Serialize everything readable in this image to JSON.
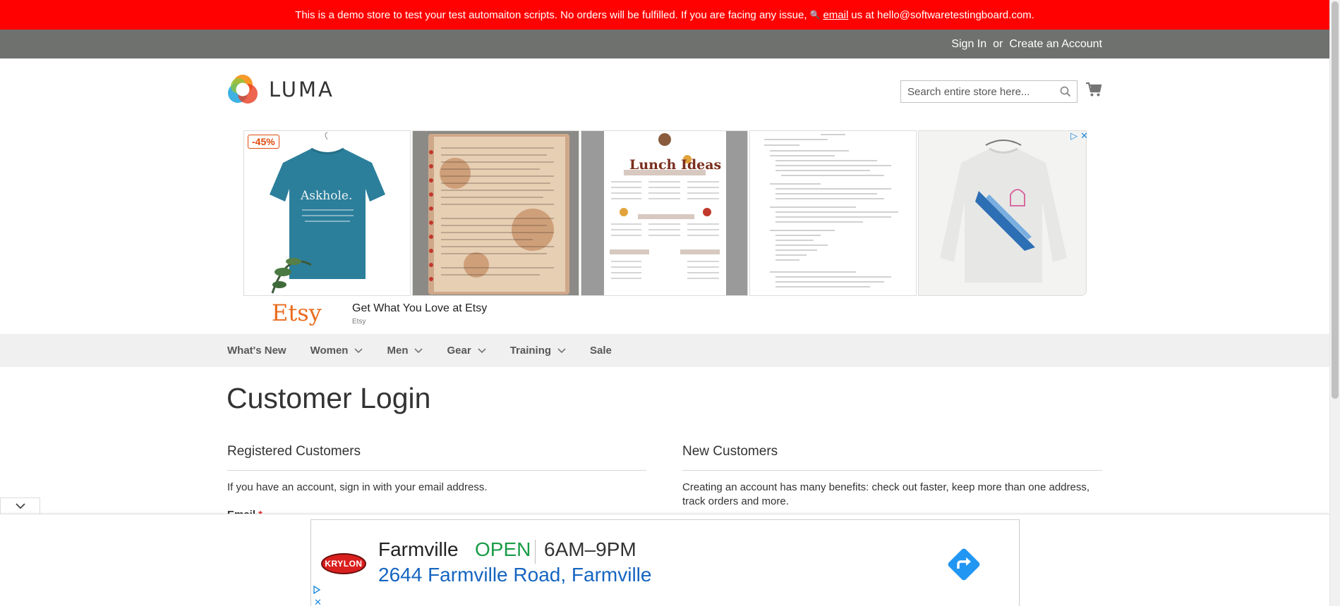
{
  "demo_notice": {
    "text_before": "This is a demo store to test your test automaiton scripts. No orders will be fulfilled. If you are facing any issue,",
    "email_link": "email",
    "text_after": "us at hello@softwaretestingboard.com."
  },
  "header": {
    "sign_in": "Sign In",
    "or": "or",
    "create_account": "Create an Account",
    "logo_text": "LUMA",
    "search_placeholder": "Search entire store here...",
    "search_icon": "search-icon",
    "cart_icon": "cart-icon"
  },
  "ad_banner": {
    "badge": "-45%",
    "tiles": [
      {
        "name": "askhole-tshirt",
        "text": "Askhole."
      },
      {
        "name": "vintage-recipe-book"
      },
      {
        "name": "lunch-ideas-printable",
        "text": "Lunch Ideas"
      },
      {
        "name": "document-printable"
      },
      {
        "name": "vintage-sweatshirt"
      }
    ],
    "advertiser_logo": "Etsy",
    "headline": "Get What You Love at Etsy",
    "sponsor": "Etsy",
    "colors": {
      "etsy": "#ea6b1c",
      "badge": "#e04a0c"
    }
  },
  "nav": {
    "items": [
      {
        "label": "What's New",
        "has_dropdown": false
      },
      {
        "label": "Women",
        "has_dropdown": true
      },
      {
        "label": "Men",
        "has_dropdown": true
      },
      {
        "label": "Gear",
        "has_dropdown": true
      },
      {
        "label": "Training",
        "has_dropdown": true
      },
      {
        "label": "Sale",
        "has_dropdown": false
      }
    ]
  },
  "page": {
    "title": "Customer Login",
    "registered": {
      "title": "Registered Customers",
      "text": "If you have an account, sign in with your email address.",
      "email_label": "Email",
      "required_mark": "*"
    },
    "new_customers": {
      "title": "New Customers",
      "text": "Creating an account has many benefits: check out faster, keep more than one address, track orders and more."
    }
  },
  "bottom_ad": {
    "brand": "KRYLON",
    "store_name": "Farmville",
    "status": "OPEN",
    "hours": "6AM–9PM",
    "address": "2644 Farmville Road, Farmville",
    "colors": {
      "open": "#1a9b48",
      "address": "#1565c0",
      "brand": "#d9201e",
      "directions": "#2196f3"
    }
  },
  "colors": {
    "demo_bar": "#ff0101",
    "panel_bar": "#6e716e",
    "nav_bg": "#f0f0f0"
  }
}
